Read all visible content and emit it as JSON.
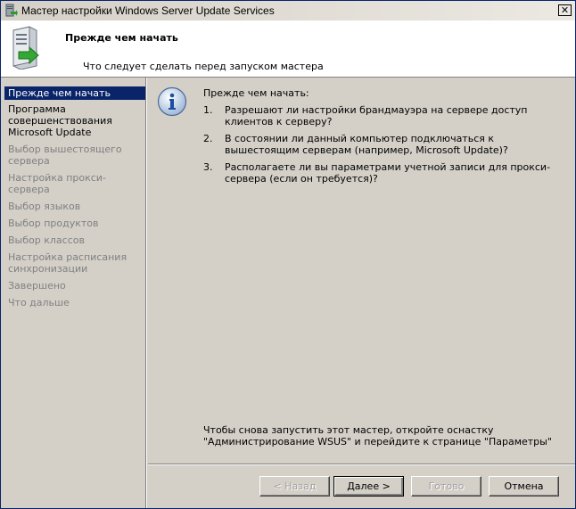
{
  "window": {
    "title": "Мастер настройки Windows Server Update Services",
    "close_label": "✕"
  },
  "header": {
    "title": "Прежде чем начать",
    "subtitle": "Что следует сделать перед запуском мастера"
  },
  "sidebar": {
    "items": [
      {
        "label": "Прежде чем начать",
        "state": "active"
      },
      {
        "label": "Программа совершенствования Microsoft Update",
        "state": "enabled"
      },
      {
        "label": "Выбор вышестоящего сервера",
        "state": "disabled"
      },
      {
        "label": "Настройка прокси-сервера",
        "state": "disabled"
      },
      {
        "label": "Выбор языков",
        "state": "disabled"
      },
      {
        "label": "Выбор продуктов",
        "state": "disabled"
      },
      {
        "label": "Выбор классов",
        "state": "disabled"
      },
      {
        "label": "Настройка расписания синхронизации",
        "state": "disabled"
      },
      {
        "label": "Завершено",
        "state": "disabled"
      },
      {
        "label": "Что дальше",
        "state": "disabled"
      }
    ]
  },
  "content": {
    "title": "Прежде чем начать:",
    "questions": [
      {
        "num": "1.",
        "text": "Разрешают ли настройки брандмауэра на сервере доступ клиентов к серверу?"
      },
      {
        "num": "2.",
        "text": "В состоянии ли данный компьютер подключаться к вышестоящим серверам (например, Microsoft Update)?"
      },
      {
        "num": "3.",
        "text": "Располагаете ли вы параметрами учетной записи для прокси-сервера (если он требуется)?"
      }
    ],
    "footer_note": "Чтобы снова запустить этот мастер, откройте оснастку \"Администрирование WSUS\" и перейдите к странице \"Параметры\""
  },
  "buttons": {
    "back": "< Назад",
    "next": "Далее >",
    "finish": "Готово",
    "cancel": "Отмена"
  },
  "icons": {
    "title": "wsus-app-icon",
    "header": "server-update-icon",
    "info": "info-icon"
  }
}
